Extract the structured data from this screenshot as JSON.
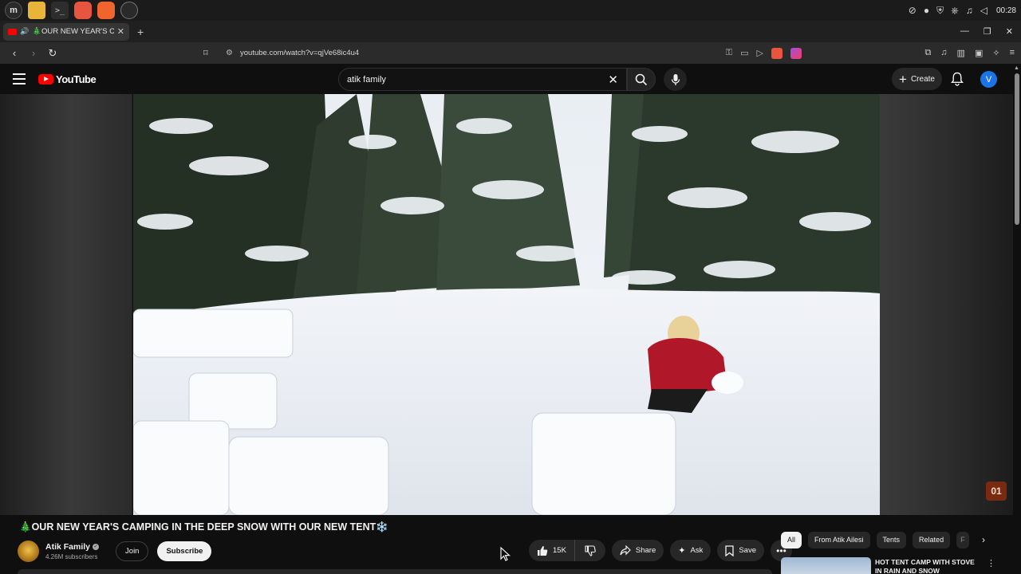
{
  "os": {
    "apps": [
      "menu-icon",
      "files-icon",
      "terminal-icon",
      "firefox-icon",
      "brave-icon",
      "chrome-icon"
    ],
    "clock": "00:28"
  },
  "browser": {
    "tab_title": "🎄OUR NEW YEAR'S CAMPING",
    "url": "youtube.com/watch?v=qjVe68ic4u4",
    "reward_count": "1"
  },
  "youtube": {
    "logo_text": "YouTube",
    "search_value": "atik family",
    "create_label": "Create",
    "avatar_letter": "V"
  },
  "video": {
    "title": "🎄OUR NEW YEAR'S CAMPING IN THE DEEP SNOW WITH OUR NEW TENT❄️",
    "channel_badge": "01"
  },
  "channel": {
    "name": "Atik Family",
    "subscribers": "4.26M subscribers",
    "join_label": "Join",
    "subscribe_label": "Subscribe"
  },
  "actions": {
    "like_count": "15K",
    "share_label": "Share",
    "ask_label": "Ask",
    "save_label": "Save"
  },
  "chips": [
    "All",
    "From Atik Ailesi",
    "Tents",
    "Related",
    "F"
  ],
  "recommendation": {
    "title": "HOT TENT CAMP WITH STOVE IN RAIN AND SNOW"
  }
}
